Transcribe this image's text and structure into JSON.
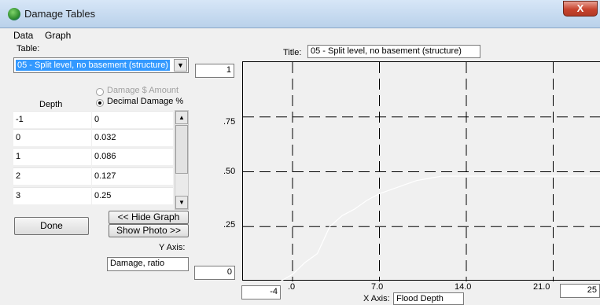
{
  "window": {
    "title": "Damage Tables",
    "close_symbol": "X"
  },
  "menu": {
    "items": [
      "Data",
      "Graph"
    ]
  },
  "table": {
    "label": "Table:",
    "selected": "05 - Split level, no basement (structure)"
  },
  "mode": {
    "option_amount": "Damage $ Amount",
    "option_percent": "Decimal Damage %",
    "selected": "Decimal Damage %"
  },
  "grid": {
    "header_depth": "Depth",
    "rows": [
      {
        "depth": "-1",
        "damage": "0"
      },
      {
        "depth": "0",
        "damage": "0.032"
      },
      {
        "depth": "1",
        "damage": "0.086"
      },
      {
        "depth": "2",
        "damage": "0.127"
      },
      {
        "depth": "3",
        "damage": "0.25"
      }
    ]
  },
  "buttons": {
    "done": "Done",
    "hide_graph": "<< Hide Graph",
    "show_photo": "Show Photo >>"
  },
  "y_axis": {
    "label": "Y Axis:",
    "value": "Damage, ratio",
    "max_value": "1",
    "min_value": "0"
  },
  "graph_title": {
    "label": "Title:",
    "value": "05 - Split level, no basement (structure)"
  },
  "x_axis": {
    "label": "X Axis:",
    "value": "Flood Depth",
    "min_value": "-4",
    "max_value": "25"
  },
  "chart_data": {
    "type": "line",
    "y_ticks": [
      ".75",
      ".50",
      ".25"
    ],
    "x_ticks": [
      ".0",
      "7.0",
      "14.0",
      "21.0"
    ],
    "xlim": [
      -4,
      25
    ],
    "ylim": [
      0,
      1
    ],
    "grid": true,
    "series": [
      {
        "x": [
          -1,
          0,
          1,
          2,
          3,
          4,
          5,
          6,
          7,
          8,
          9,
          10,
          11,
          12,
          13,
          14,
          15,
          16,
          17,
          18,
          19,
          20,
          21,
          22,
          23,
          24,
          25
        ],
        "y": [
          0,
          0.032,
          0.086,
          0.127,
          0.25,
          0.3,
          0.33,
          0.37,
          0.4,
          0.42,
          0.44,
          0.46,
          0.47,
          0.48,
          0.48,
          0.48,
          0.48,
          0.48,
          0.48,
          0.48,
          0.48,
          0.48,
          0.48,
          0.48,
          0.48,
          0.48,
          0.48
        ]
      }
    ],
    "line_color": "#ffffff",
    "grid_color": "#000000"
  }
}
